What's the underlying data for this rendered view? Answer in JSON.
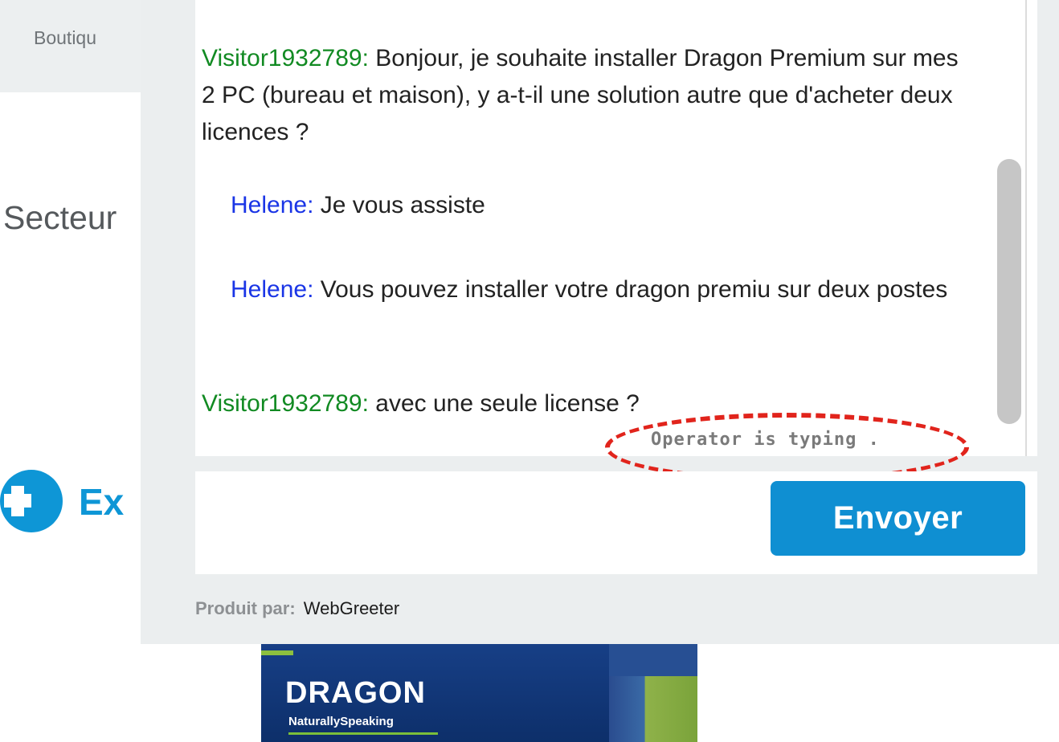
{
  "background_page": {
    "tab_label": "Boutiqu",
    "section_heading": "Secteur",
    "expand_link": "Ex",
    "product_box": {
      "title": "DRAGON",
      "subtitle": "NaturallySpeaking"
    }
  },
  "chat": {
    "messages": [
      {
        "author": "Visitor1932789:",
        "role": "visitor",
        "text": "Bonjour, je souhaite installer Dragon Premium sur mes 2 PC (bureau et maison), y a-t-il une solution autre que d'acheter deux licences ?"
      },
      {
        "author": "Helene:",
        "role": "operator",
        "text": "Je vous assiste"
      },
      {
        "author": "Helene:",
        "role": "operator",
        "text": "Vous pouvez installer votre dragon premiu sur deux postes"
      },
      {
        "author": "Visitor1932789:",
        "role": "visitor",
        "text": "avec une seule license ?"
      }
    ],
    "typing_indicator": "Operator is typing .",
    "input": {
      "value": "",
      "placeholder": ""
    },
    "send_button_label": "Envoyer",
    "footer": {
      "label": "Produit par:",
      "brand": "WebGreeter"
    }
  },
  "colors": {
    "visitor_name": "#118a22",
    "operator_name": "#1a35e6",
    "send_button": "#0f8fd2",
    "annotation_ring": "#e1241c"
  }
}
